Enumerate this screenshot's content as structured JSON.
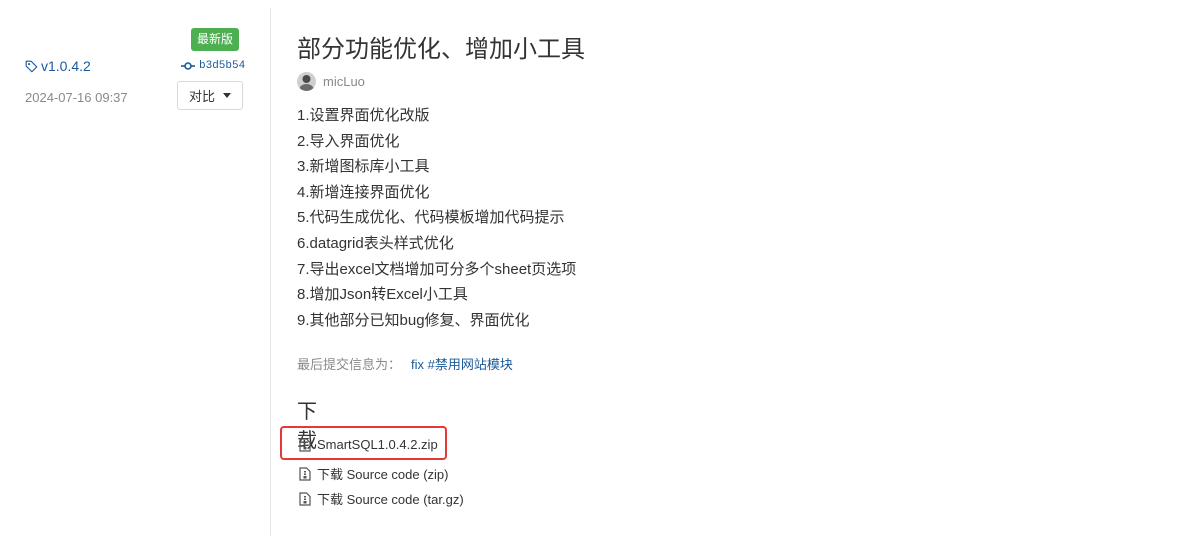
{
  "release": {
    "tag": "v1.0.4.2",
    "date": "2024-07-16 09:37",
    "latest_badge": "最新版",
    "commit": "b3d5b54",
    "compare_label": "对比"
  },
  "main": {
    "title": "部分功能优化、增加小工具",
    "author": "micLuo",
    "notes": [
      "1.设置界面优化改版",
      "2.导入界面优化",
      "3.新增图标库小工具",
      "4.新增连接界面优化",
      "5.代码生成优化、代码模板增加代码提示",
      "6.datagrid表头样式优化",
      "7.导出excel文档增加可分多个sheet页选项",
      "8.增加Json转Excel小工具",
      "9.其他部分已知bug修复、界面优化"
    ],
    "commit_msg_label": "最后提交信息为：",
    "commit_msg_value": "fix #禁用网站模块"
  },
  "downloads": {
    "title": "下载",
    "items": [
      {
        "label": "SmartSQL1.0.4.2.zip"
      },
      {
        "label": "下载 Source code (zip)"
      },
      {
        "label": "下载 Source code (tar.gz)"
      }
    ]
  },
  "colors": {
    "link": "#1a5a99",
    "badge": "#4caf50",
    "highlight": "#e53935"
  }
}
